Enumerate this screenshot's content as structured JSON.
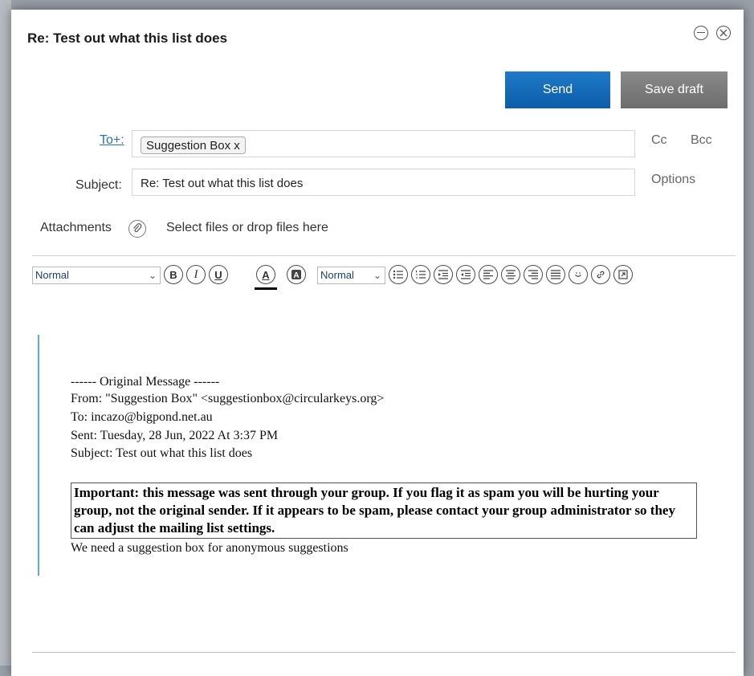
{
  "window": {
    "title": "Re: Test out what this list does"
  },
  "actions": {
    "send": "Send",
    "save_draft": "Save draft"
  },
  "compose": {
    "to_label": "To+:",
    "to_chip": "Suggestion Box x",
    "subject_label": "Subject:",
    "subject_value": "Re: Test out what this list does",
    "cc": "Cc",
    "bcc": "Bcc",
    "options": "Options",
    "attachments_label": "Attachments",
    "attachments_hint": "Select files or drop files here"
  },
  "toolbar": {
    "paragraph_style": "Normal",
    "font_size": "Normal",
    "buttons": [
      "bold",
      "italic",
      "underline",
      "font-color",
      "highlight",
      "bullet-list",
      "numbered-list",
      "indent",
      "outdent",
      "align-left",
      "align-center",
      "align-right",
      "justify",
      "emoji",
      "link",
      "source"
    ]
  },
  "message": {
    "original_header": "------ Original Message ------",
    "from": "From: \"Suggestion Box\" <suggestionbox@circularkeys.org>",
    "to": "To: incazo@bigpond.net.au",
    "sent": "Sent: Tuesday, 28 Jun, 2022 At 3:37 PM",
    "subject": "Subject: Test out what this list does",
    "notice": "Important: this message was sent through your group. If you flag it as spam you will be hurting your group, not the original sender. If it appears to be spam, please contact your group administrator so they can adjust the mailing list settings.",
    "body": "We need a suggestion box for anonymous suggestions"
  },
  "colors": {
    "send": "#0b5da8",
    "save_draft": "#6d6d6d",
    "link": "#2a6fbb",
    "quote_bar": "#5aa9e6"
  }
}
